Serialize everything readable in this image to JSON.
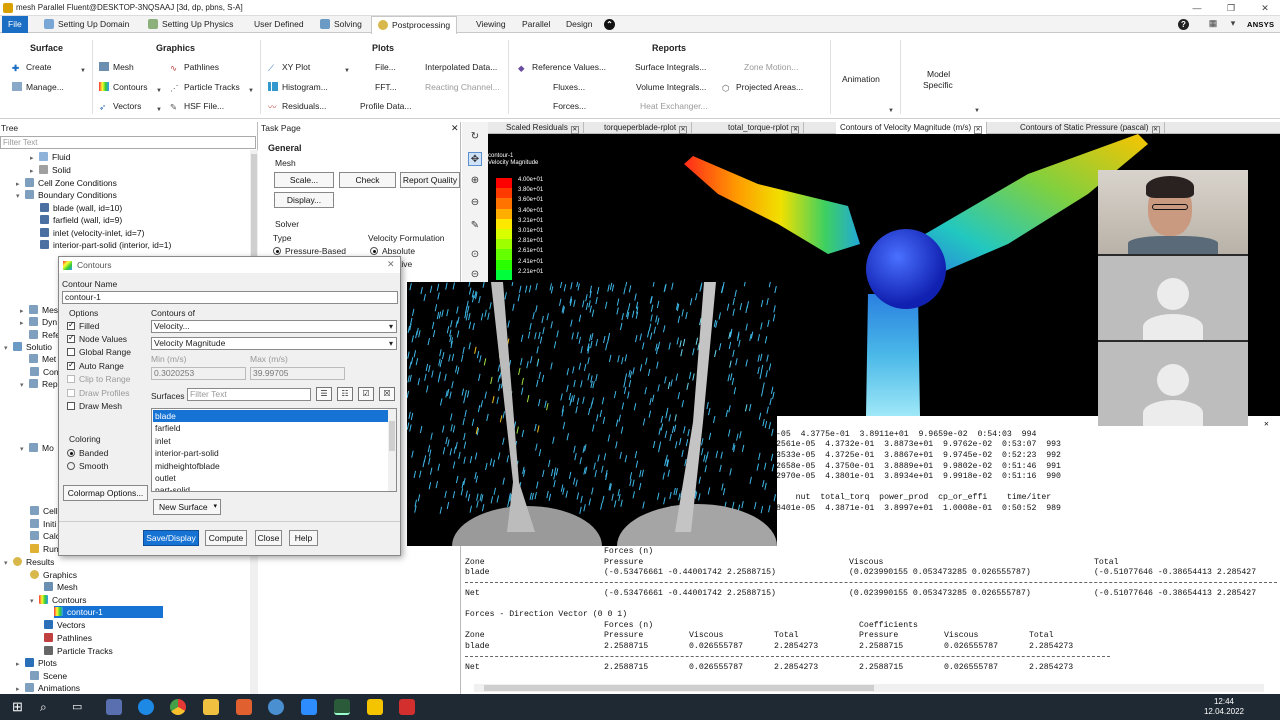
{
  "window": {
    "title": "mesh Parallel Fluent@DESKTOP-3NQSAAJ [3d, dp, pbns, S-A]"
  },
  "ribbon_tabs": [
    "File",
    "Setting Up Domain",
    "Setting Up Physics",
    "User Defined",
    "Solving",
    "Postprocessing",
    "Viewing",
    "Parallel",
    "Design"
  ],
  "active_tab": "Postprocessing",
  "brand": "ANSYS",
  "ribbon": {
    "surface": {
      "label": "Surface",
      "create": "Create",
      "manage": "Manage..."
    },
    "graphics": {
      "label": "Graphics",
      "mesh": "Mesh",
      "contours": "Contours",
      "vectors": "Vectors",
      "pathlines": "Pathlines",
      "particle_tracks": "Particle Tracks",
      "hsf_file": "HSF File..."
    },
    "plots": {
      "label": "Plots",
      "xy_plot": "XY Plot",
      "histogram": "Histogram...",
      "residuals": "Residuals...",
      "file": "File...",
      "fft": "FFT...",
      "profile_data": "Profile Data...",
      "interpolated_data": "Interpolated Data...",
      "reacting_channel": "Reacting Channel..."
    },
    "reports": {
      "label": "Reports",
      "reference_values": "Reference Values...",
      "fluxes": "Fluxes...",
      "forces": "Forces...",
      "surface_integrals": "Surface Integrals...",
      "volume_integrals": "Volume Integrals...",
      "heat_exchanger": "Heat Exchanger...",
      "zone_motion": "Zone Motion...",
      "projected_areas": "Projected Areas..."
    },
    "animation": "Animation",
    "model_specific_1": "Model",
    "model_specific_2": "Specific"
  },
  "tree": {
    "header": "Tree",
    "filter_placeholder": "Filter Text",
    "items": [
      {
        "label": "Fluid"
      },
      {
        "label": "Solid"
      },
      {
        "label": "Cell Zone Conditions"
      },
      {
        "label": "Boundary Conditions"
      },
      {
        "label": "blade (wall, id=10)"
      },
      {
        "label": "farfield (wall, id=9)"
      },
      {
        "label": "inlet (velocity-inlet, id=7)"
      },
      {
        "label": "interior-part-solid (interior, id=1)"
      }
    ],
    "partial_items": [
      "Mes",
      "Dyn",
      "Refe",
      "Solutio",
      "Met",
      "Con",
      "Rep",
      "Mo",
      "Cell",
      "Initi",
      "Calc",
      "Run"
    ],
    "results_items": [
      {
        "label": "Results"
      },
      {
        "label": "Graphics"
      },
      {
        "label": "Mesh"
      },
      {
        "label": "Contours"
      },
      {
        "label": "contour-1"
      },
      {
        "label": "Vectors"
      },
      {
        "label": "Pathlines"
      },
      {
        "label": "Particle Tracks"
      },
      {
        "label": "Plots"
      },
      {
        "label": "Scene"
      },
      {
        "label": "Animations"
      }
    ]
  },
  "task_page": {
    "header": "Task Page",
    "title": "General",
    "mesh_label": "Mesh",
    "scale_btn": "Scale...",
    "check_btn": "Check",
    "report_quality_btn": "Report Quality",
    "display_btn": "Display...",
    "solver_label": "Solver",
    "type_label": "Type",
    "type_option": "Pressure-Based",
    "velocity_label": "Velocity Formulation",
    "velocity_option": "Absolute",
    "velocity_option2": "tive"
  },
  "graphics_tabs": [
    "Scaled Residuals",
    "torqueperblade-rplot",
    "total_torque-rplot",
    "Contours of Velocity Magnitude (m/s)",
    "Contours of Static Pressure (pascal)"
  ],
  "legend": {
    "title_1": "contour-1",
    "title_2": "Velocity Magnitude",
    "labels": [
      "4.00e+01",
      "3.80e+01",
      "3.60e+01",
      "3.40e+01",
      "3.21e+01",
      "3.01e+01",
      "2.81e+01",
      "2.61e+01",
      "2.41e+01",
      "2.21e+01"
    ],
    "colors": [
      "#ff0000",
      "#ff3a00",
      "#ff7400",
      "#ffae00",
      "#ffe800",
      "#d8ff00",
      "#9eff00",
      "#64ff00",
      "#2aff00",
      "#00ff3a"
    ]
  },
  "dialog": {
    "title": "Contours",
    "contour_name_label": "Contour Name",
    "contour_name": "contour-1",
    "options_label": "Options",
    "opt_filled": "Filled",
    "opt_node_values": "Node Values",
    "opt_global_range": "Global Range",
    "opt_auto_range": "Auto Range",
    "opt_clip": "Clip to Range",
    "opt_draw_profiles": "Draw Profiles",
    "opt_draw_mesh": "Draw Mesh",
    "contours_of_label": "Contours of",
    "contours_of_1": "Velocity...",
    "contours_of_2": "Velocity Magnitude",
    "min_label": "Min (m/s)",
    "max_label": "Max (m/s)",
    "min_value": "0.3020253",
    "max_value": "39.99705",
    "surfaces_label": "Surfaces",
    "surfaces_filter": "Filter Text",
    "surfaces": [
      "blade",
      "farfield",
      "inlet",
      "interior-part-solid",
      "midheightofblade",
      "outlet",
      "part-solid"
    ],
    "coloring_label": "Coloring",
    "coloring_banded": "Banded",
    "coloring_smooth": "Smooth",
    "colormap_btn": "Colormap Options...",
    "new_surface_btn": "New Surface",
    "save_display_btn": "Save/Display",
    "compute_btn": "Compute",
    "close_btn": "Close",
    "help_btn": "Help"
  },
  "console": {
    "iter_lines": [
      "-05  4.3775e-01  3.8911e+01  9.9659e-02  0:54:03  994",
      "2561e-05  4.3732e-01  3.8873e+01  9.9762e-02  0:53:07  993",
      "3533e-05  4.3725e-01  3.8867e+01  9.9745e-02  0:52:23  992",
      "2658e-05  4.3750e-01  3.8889e+01  9.9802e-02  0:51:46  991",
      "2970e-05  4.3801e-01  3.8934e+01  9.9918e-02  0:51:16  990"
    ],
    "iter_header": "    nut  total_torq  power_prod  cp_or_effi    time/iter",
    "iter_last": "8401e-05  4.3871e-01  3.8997e+01  1.0008e-01  0:50:52  989",
    "forces_title": "Forces (n)",
    "col_zone": "Zone",
    "col_pressure": "Pressure",
    "col_viscous": "Viscous",
    "col_total": "Total",
    "row_blade": "blade",
    "blade_pressure": "(-0.53476661 -0.44001742 2.2588715)",
    "blade_viscous": "(0.023990155 0.053473285 0.026555787)",
    "blade_total": "(-0.51077646 -0.38654413 2.285427",
    "row_net": "Net",
    "net_pressure": "(-0.53476661 -0.44001742 2.2588715)",
    "net_viscous": "(0.023990155 0.053473285 0.026555787)",
    "net_total": "(-0.51077646 -0.38654413 2.285427",
    "dir_title": "Forces - Direction Vector (0 0 1)",
    "sub_forces": "Forces (n)",
    "sub_coeffs": "Coefficients",
    "col_zone2": "Zone",
    "col_pressure2": "Pressure",
    "col_viscous2": "Viscous",
    "col_total2": "Total",
    "col_pressure3": "Pressure",
    "col_viscous3": "Viscous",
    "col_total3": "Total",
    "d_blade": "blade",
    "d_blade_p": "2.2588715",
    "d_blade_v": "0.026555787",
    "d_blade_t": "2.2854273",
    "d_blade_cp": "2.2588715",
    "d_blade_cv": "0.026555787",
    "d_blade_ct": "2.2854273",
    "d_net": "Net",
    "d_net_p": "2.2588715",
    "d_net_v": "0.026555787",
    "d_net_t": "2.2854273",
    "d_net_cp": "2.2588715",
    "d_net_cv": "0.026555787",
    "d_net_ct": "2.2854273"
  },
  "taskbar": {
    "time": "12:44",
    "date": "12.04.2022"
  },
  "colors": {
    "accent": "#1673d4",
    "taskbar": "#1f2933"
  }
}
